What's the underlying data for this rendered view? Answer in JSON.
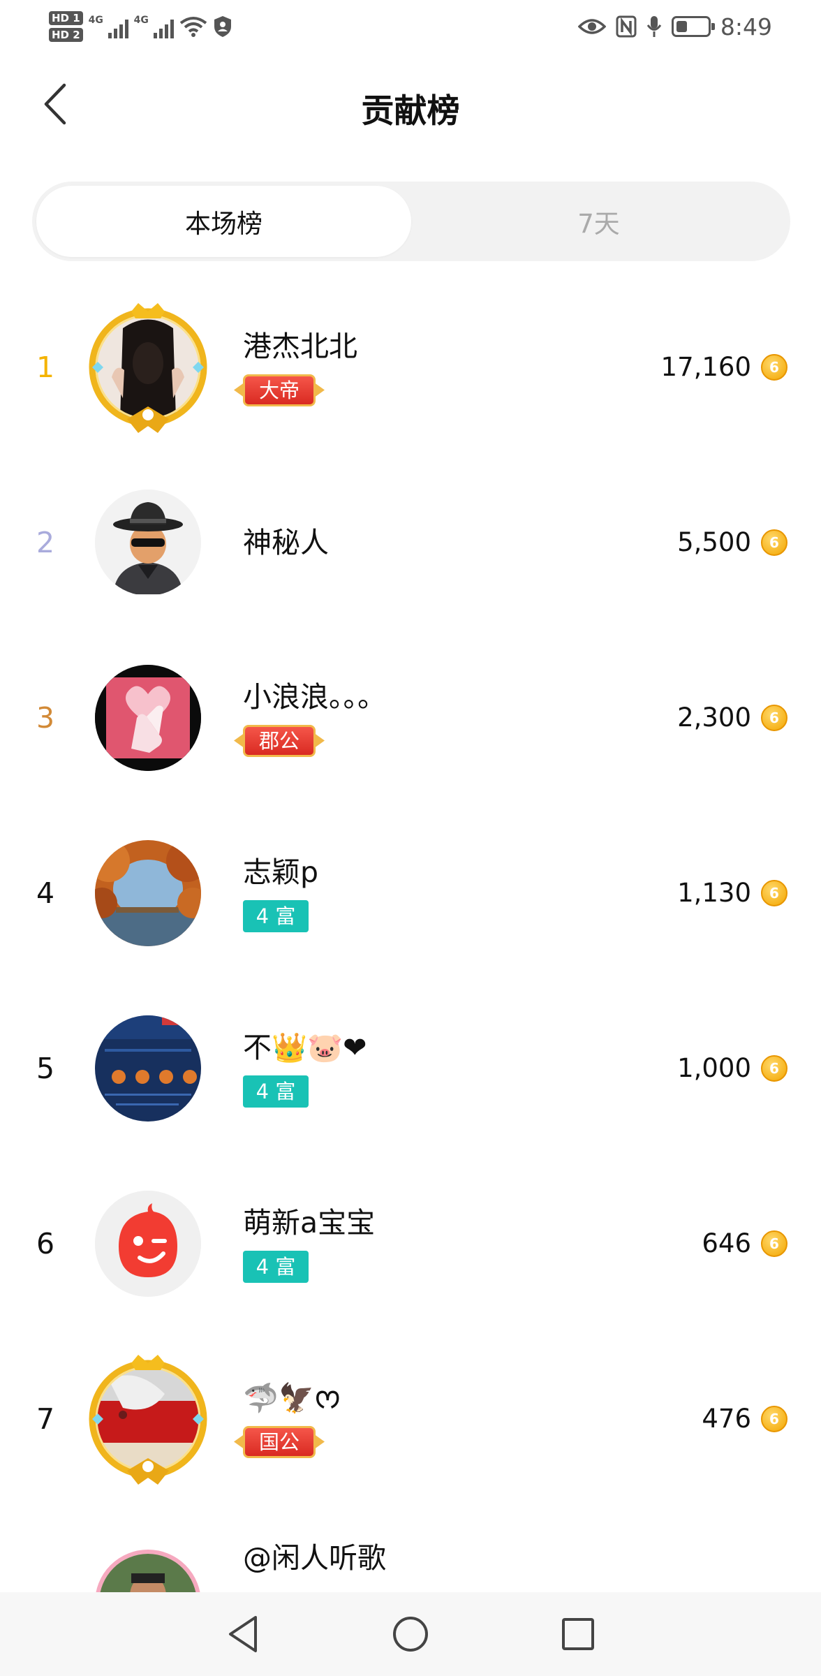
{
  "status_bar": {
    "hd1": "HD 1",
    "hd2": "HD 2",
    "net1": "4G",
    "net2": "4G",
    "time": "8:49",
    "battery_level": 0.35
  },
  "header": {
    "title": "贡献榜"
  },
  "tabs": [
    {
      "label": "本场榜",
      "active": true
    },
    {
      "label": "7天",
      "active": false
    }
  ],
  "leaderboard": [
    {
      "rank": "1",
      "name": "港杰北北",
      "badge": "大帝",
      "badge_style": "red",
      "score": "17,160"
    },
    {
      "rank": "2",
      "name": "神秘人",
      "badge": "",
      "badge_style": "",
      "score": "5,500"
    },
    {
      "rank": "3",
      "name": "小浪浪。。。",
      "badge": "郡公",
      "badge_style": "red",
      "score": "2,300"
    },
    {
      "rank": "4",
      "name": "志颖p",
      "badge": "4 富",
      "badge_style": "teal",
      "score": "1,130"
    },
    {
      "rank": "5",
      "name": "不👑🐷❤",
      "badge": "4 富",
      "badge_style": "teal",
      "score": "1,000"
    },
    {
      "rank": "6",
      "name": "萌新a宝宝",
      "badge": "4 富",
      "badge_style": "teal",
      "score": "646"
    },
    {
      "rank": "7",
      "name": "🦈🦅ᰔ",
      "badge": "国公",
      "badge_style": "red",
      "score": "476"
    },
    {
      "rank": "",
      "name": "@闲人听歌",
      "badge": "",
      "badge_style": "",
      "score": ""
    }
  ],
  "coin_glyph": "6",
  "colors": {
    "rank1": "#f4b300",
    "rank2": "#a9abdc",
    "rank3": "#d28a37",
    "teal_badge": "#19c2b5",
    "red_badge": "#e0352b",
    "coin": "#f3a600"
  }
}
